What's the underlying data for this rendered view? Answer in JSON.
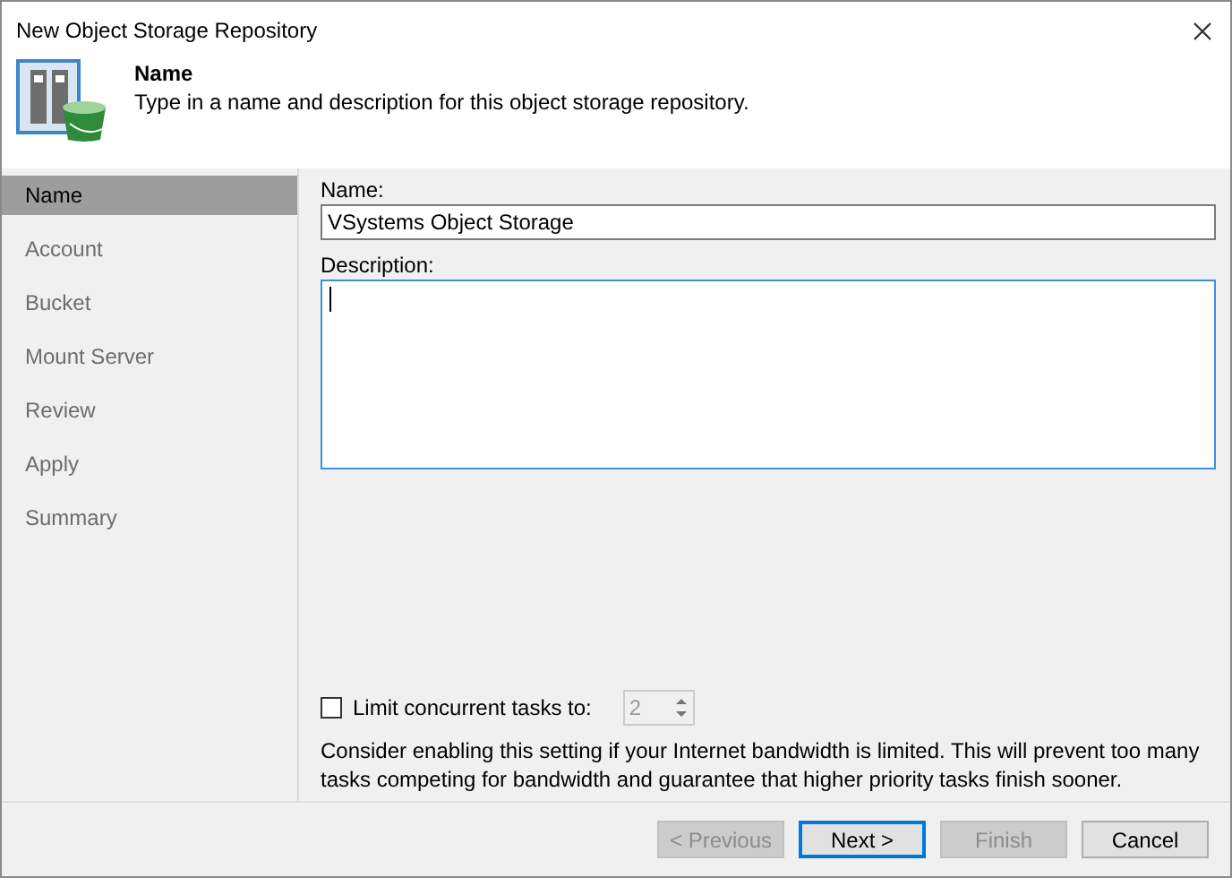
{
  "window": {
    "title": "New Object Storage Repository"
  },
  "header": {
    "title": "Name",
    "description": "Type in a name and description for this object storage repository."
  },
  "steps": [
    {
      "label": "Name",
      "selected": true
    },
    {
      "label": "Account",
      "selected": false
    },
    {
      "label": "Bucket",
      "selected": false
    },
    {
      "label": "Mount Server",
      "selected": false
    },
    {
      "label": "Review",
      "selected": false
    },
    {
      "label": "Apply",
      "selected": false
    },
    {
      "label": "Summary",
      "selected": false
    }
  ],
  "name_field": {
    "label": "Name:",
    "value": "VSystems Object Storage",
    "focused": false
  },
  "description_field": {
    "label": "Description:",
    "focused": true
  },
  "limit_tasks": {
    "label": "Limit concurrent tasks to:",
    "checked": false,
    "value": "2",
    "disabled": true
  },
  "hint": "Consider enabling this setting if your Internet bandwidth is limited. This will prevent too many tasks competing for bandwidth and guarantee that higher priority tasks finish sooner.",
  "buttons": [
    {
      "label": "< Previous",
      "disabled": true,
      "default": false
    },
    {
      "label": "Next >",
      "disabled": false,
      "default": true
    },
    {
      "label": "Finish",
      "disabled": true,
      "default": false
    },
    {
      "label": "Cancel",
      "disabled": false,
      "default": false
    }
  ]
}
